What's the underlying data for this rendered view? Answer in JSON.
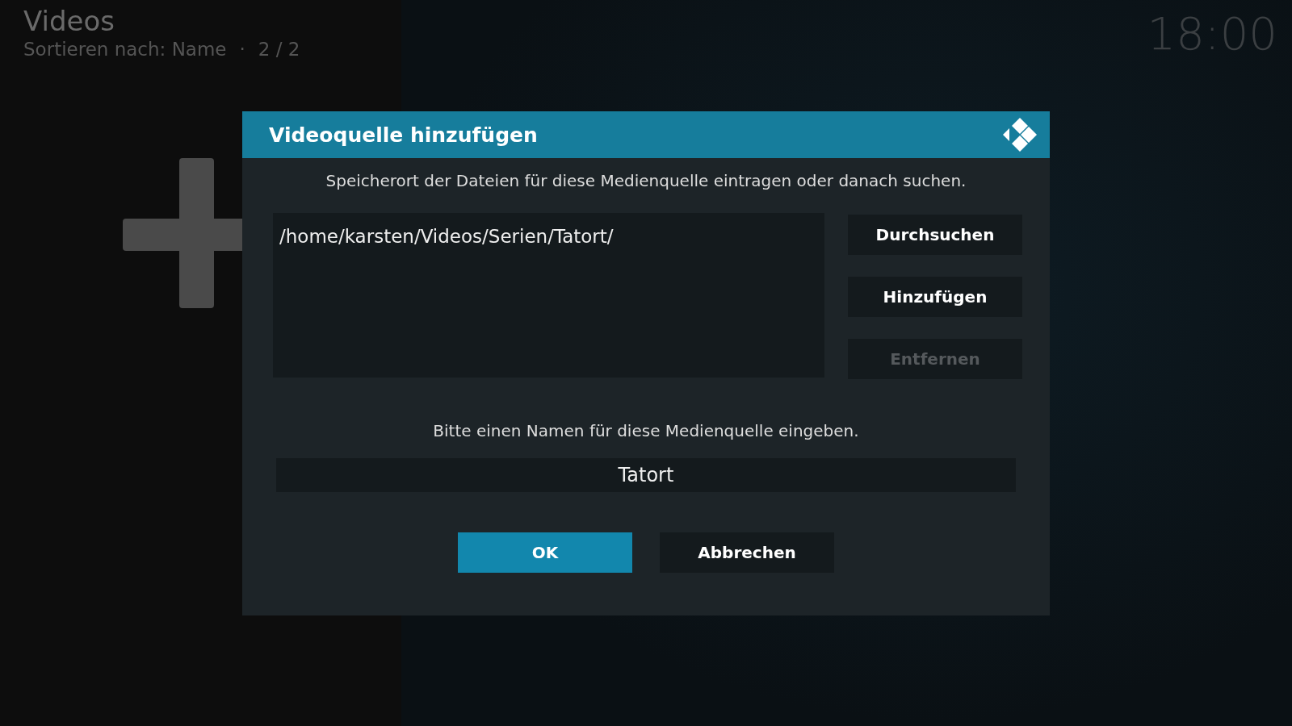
{
  "header": {
    "title": "Videos",
    "sort_label": "Sortieren nach: Name",
    "separator": "·",
    "count": "2 / 2",
    "clock": "18:00"
  },
  "dialog": {
    "title": "Videoquelle hinzufügen",
    "instruction": "Speicherort der Dateien für diese Medienquelle eintragen oder danach suchen.",
    "paths": [
      {
        "label": "/home/karsten/Videos/Serien/Tatort/",
        "selected": false
      }
    ],
    "side_buttons": [
      {
        "label": "Durchsuchen",
        "disabled": false,
        "focused": false
      },
      {
        "label": "Hinzufügen",
        "disabled": false,
        "focused": false
      },
      {
        "label": "Entfernen",
        "disabled": true,
        "focused": false
      }
    ],
    "name_prompt": "Bitte einen Namen für diese Medienquelle eingeben.",
    "name_value": "Tatort",
    "buttons": [
      {
        "label": "OK",
        "focused": true
      },
      {
        "label": "Abbrechen",
        "focused": false
      }
    ]
  }
}
